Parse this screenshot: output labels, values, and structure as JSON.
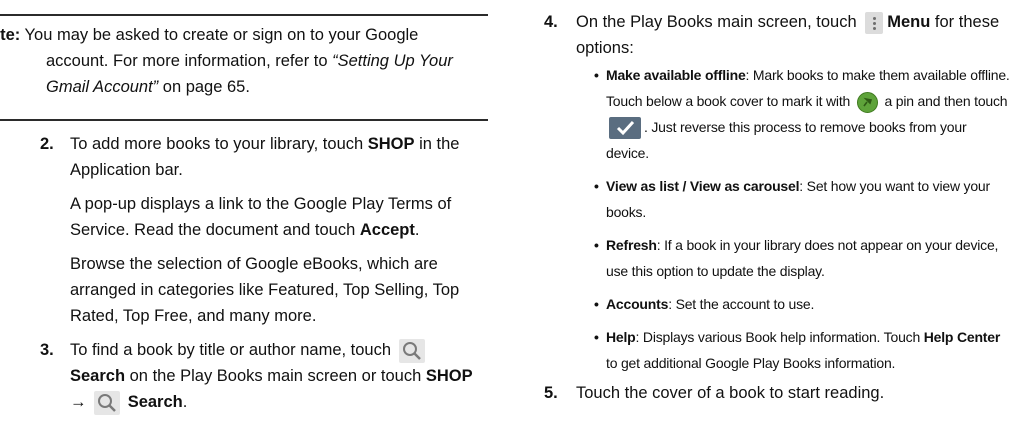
{
  "note": {
    "label": "ote:",
    "line1": " You may be asked to create or sign on to your Google",
    "line2": "account. For more information, refer to ",
    "ref_title": "“Setting Up Your Gmail Account”",
    "ref_page": " on page 65."
  },
  "steps": {
    "s2": {
      "num": "2.",
      "p1a": "To add more books to your library, touch ",
      "p1b": "SHOP",
      "p1c": " in the Application bar.",
      "p2a": "A pop-up displays a link to the Google Play Terms of Service. Read the document and touch ",
      "p2b": "Accept",
      "p2c": ".",
      "p3": "Browse the selection of Google eBooks, which are arranged in categories like Featured, Top Selling, Top Rated, Top Free, and many more."
    },
    "s3": {
      "num": "3.",
      "a": "To find a book by title or author name, touch ",
      "b": "Search",
      "c": " on the Play Books main screen or touch ",
      "d": "SHOP",
      "arrow": "→",
      "e": "Search",
      "f": "."
    },
    "s4": {
      "num": "4.",
      "a": "On the Play Books main screen, touch ",
      "b": "Menu",
      "c": " for these options:"
    },
    "s5": {
      "num": "5.",
      "text": "Touch the cover of a book to start reading."
    }
  },
  "bullets": {
    "b1": {
      "term": "Make available offline",
      "t1": ": Mark books to make them available offline. Touch below a book cover to mark it with ",
      "t2": " a pin and then touch ",
      "t3": ". Just reverse this process to remove books from your device."
    },
    "b2": {
      "term": "View as list / View as carousel",
      "t1": ": Set how you want to view your books."
    },
    "b3": {
      "term": "Refresh",
      "t1": ": If a book in your library does not appear on your device, use this option to update the display."
    },
    "b4": {
      "term": "Accounts",
      "t1": ": Set the account to use."
    },
    "b5": {
      "term": "Help",
      "t1": ": Displays various Book help information. Touch ",
      "t2": "Help Center",
      "t3": " to get additional Google Play Books information."
    }
  },
  "icons": {
    "menu": "menu-icon",
    "search": "search-icon",
    "pin": "pin-icon",
    "check": "checkmark-icon",
    "pin_color": "#5ea33a",
    "check_color": "#5a6d80"
  }
}
